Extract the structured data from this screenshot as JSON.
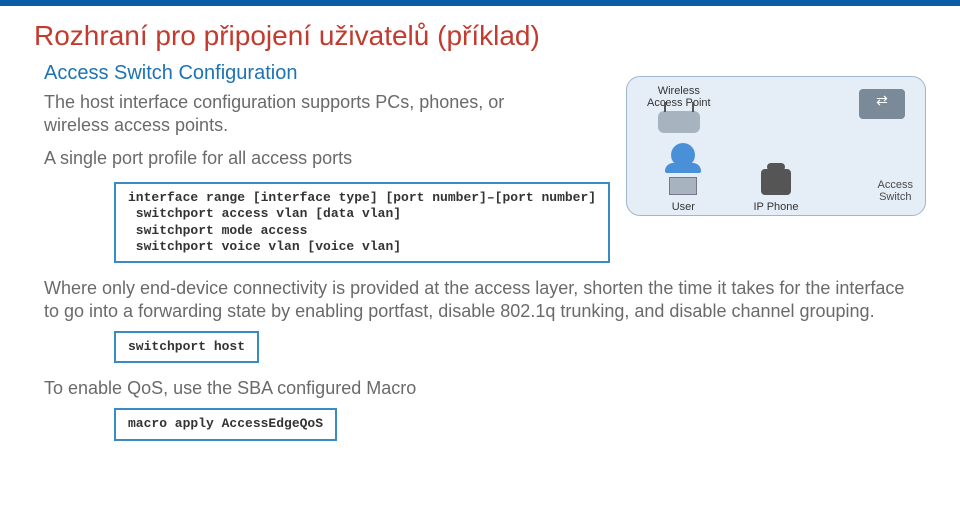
{
  "title": "Rozhraní pro připojení uživatelů (příklad)",
  "subheading": "Access Switch Configuration",
  "intro": "The host interface configuration supports PCs, phones, or wireless access points.",
  "single_port": "A single port profile for all access ports",
  "code1": "interface range [interface type] [port number]–[port number]\n switchport access vlan [data vlan]\n switchport mode access\n switchport voice vlan [voice vlan]",
  "end_device_text": "Where only end-device connectivity is provided at the access layer, shorten the time it takes for the interface to go into a forwarding state by enabling portfast, disable 802.1q trunking, and disable channel grouping.",
  "code2": "switchport host",
  "qos_text": "To enable QoS, use the SBA configured Macro",
  "code3": "macro apply AccessEdgeQoS",
  "diagram": {
    "wap": "Wireless\nAccess Point",
    "user": "User",
    "ip_phone": "IP Phone",
    "access_switch": "Access\nSwitch"
  }
}
